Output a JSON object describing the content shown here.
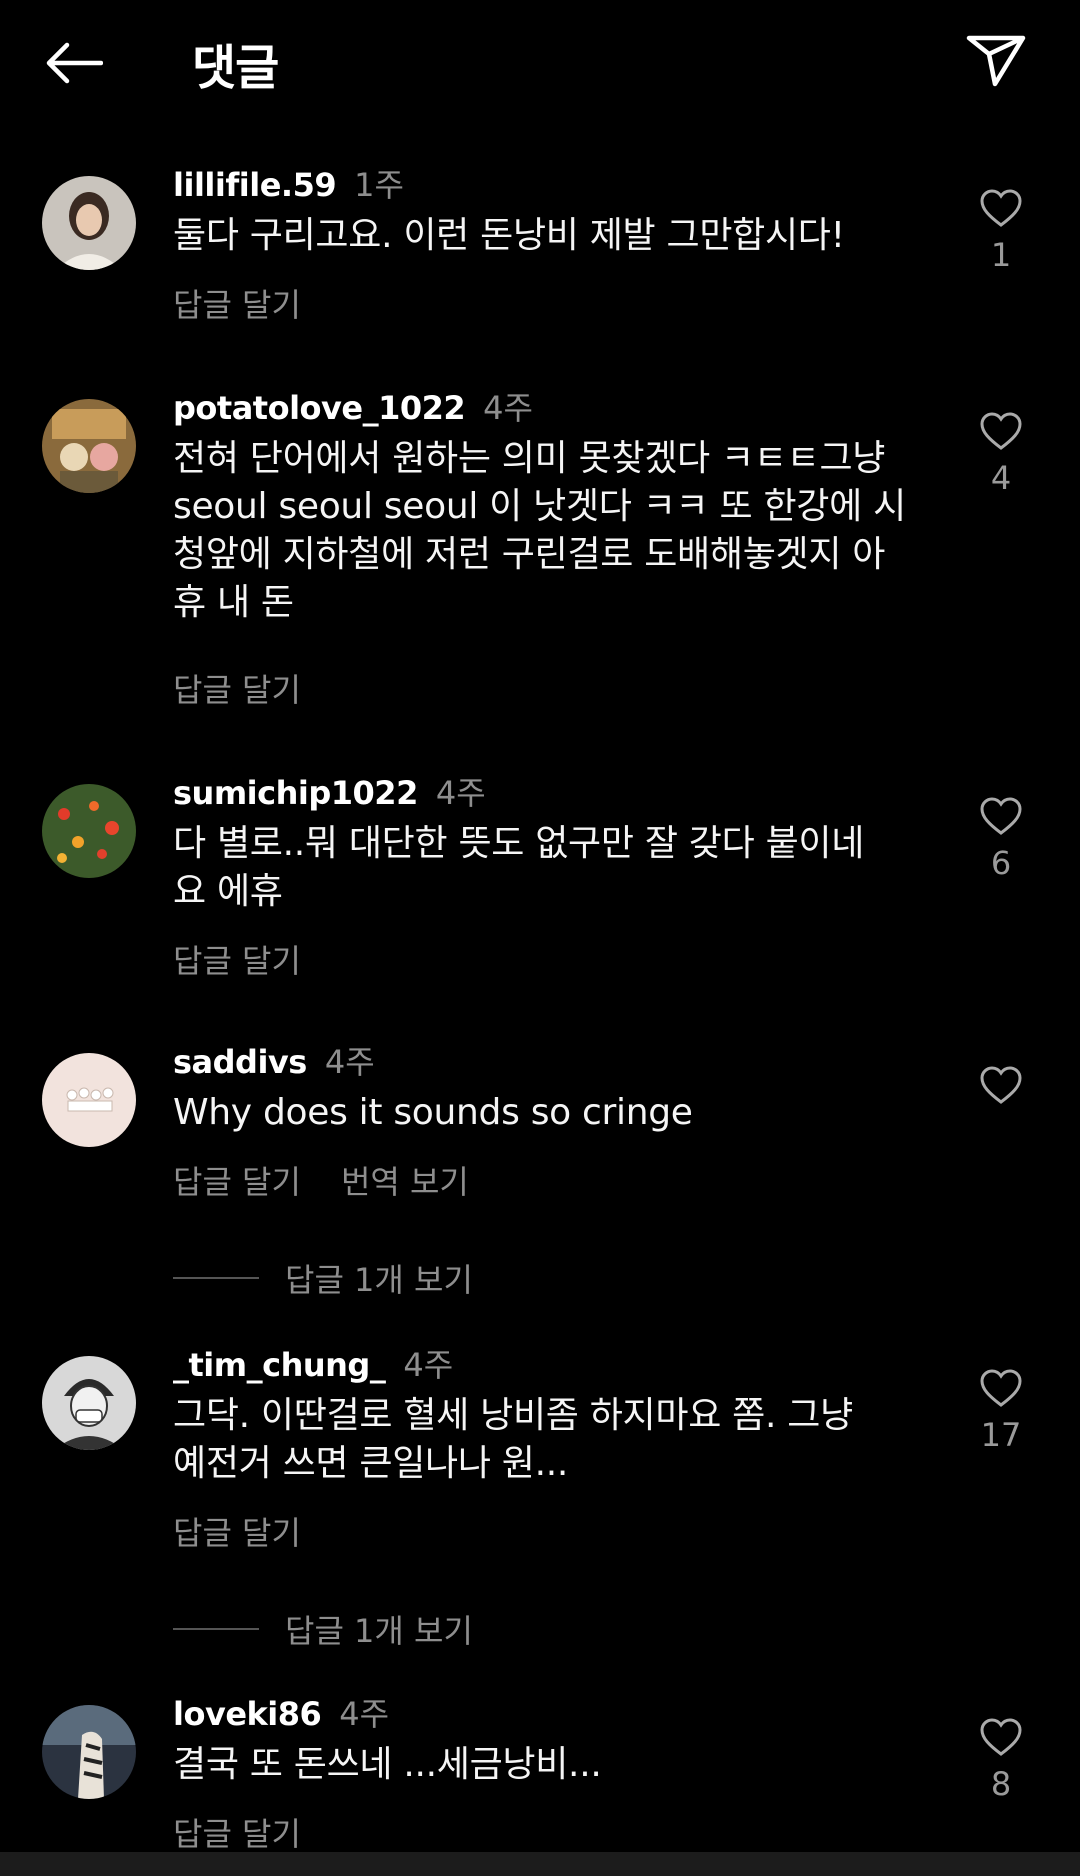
{
  "header": {
    "title": "댓글",
    "back_icon": "arrow-left-icon",
    "send_icon": "paper-plane-icon"
  },
  "comments": [
    {
      "username": "lillifile.59",
      "time": "1주",
      "lines": [
        "둘다 구리고요. 이런 돈낭비 제발 그만합시다!"
      ],
      "likes": "1",
      "reply_label": "답글 달기"
    },
    {
      "username": "potatolove_1022",
      "time": "4주",
      "lines": [
        "전혀 단어에서 원하는 의미 못찾겠다 ㅋㅌㅌ그냥",
        "seoul seoul seoul 이 낫겟다 ㅋㅋ 또 한강에 시",
        "청앞에 지하철에 저런 구린걸로 도배해놓겟지 아",
        "휴 내 돈"
      ],
      "likes": "4",
      "reply_label": "답글 달기"
    },
    {
      "username": "sumichip1022",
      "time": "4주",
      "lines": [
        "다 별로..뭐 대단한 뜻도 없구만 잘 갖다 붙이네",
        "요 에휴"
      ],
      "likes": "6",
      "reply_label": "답글 달기"
    },
    {
      "username": "saddivs",
      "time": "4주",
      "lines": [
        "Why does it sounds so cringe"
      ],
      "likes": "",
      "reply_label": "답글 달기",
      "translate_label": "번역 보기",
      "view_replies": "답글 1개 보기"
    },
    {
      "username": "_tim_chung_",
      "time": "4주",
      "lines": [
        "그닥. 이딴걸로 혈세 낭비좀 하지마요 쫌. 그냥",
        "예전거 쓰면 큰일나나 원..."
      ],
      "likes": "17",
      "reply_label": "답글 달기",
      "view_replies": "답글 1개 보기"
    },
    {
      "username": "loveki86",
      "time": "4주",
      "lines": [
        "결국 또 돈쓰네 ...세금낭비..."
      ],
      "likes": "8",
      "reply_label": "답글 달기"
    }
  ],
  "colors": {
    "background": "#000000",
    "secondary_text": "#8e8e8e"
  }
}
